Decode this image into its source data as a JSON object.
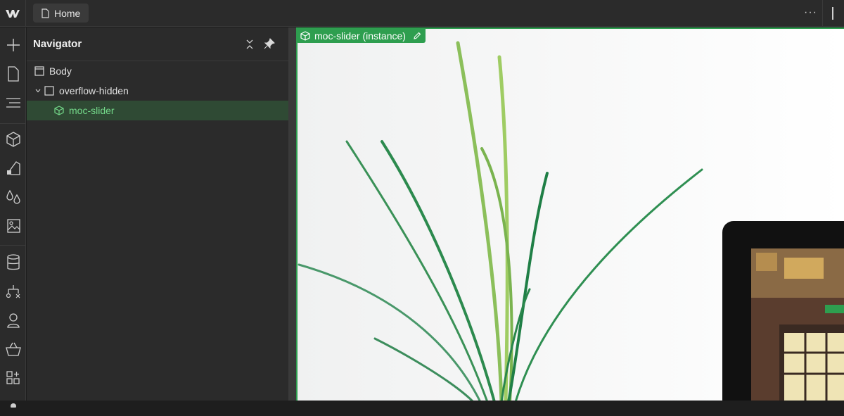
{
  "topbar": {
    "page_tab_label": "Home",
    "more_label": "···"
  },
  "left_rail": {
    "items": [
      {
        "name": "add-icon"
      },
      {
        "name": "pages-icon"
      },
      {
        "name": "navigator-icon"
      },
      {
        "name": "components-icon"
      },
      {
        "name": "style-selectors-icon"
      },
      {
        "name": "variables-icon"
      },
      {
        "name": "assets-icon"
      },
      {
        "name": "cms-icon"
      },
      {
        "name": "logic-icon"
      },
      {
        "name": "users-icon"
      },
      {
        "name": "ecommerce-icon"
      },
      {
        "name": "apps-icon"
      }
    ]
  },
  "navigator": {
    "title": "Navigator",
    "tree": [
      {
        "label": "Body",
        "icon": "body-icon",
        "depth": 0,
        "expanded": false,
        "selected": false
      },
      {
        "label": "overflow-hidden",
        "icon": "div-block-icon",
        "depth": 1,
        "expanded": true,
        "selected": false
      },
      {
        "label": "moc-slider",
        "icon": "component-instance-icon",
        "depth": 2,
        "expanded": false,
        "selected": true
      }
    ]
  },
  "canvas": {
    "selection_label": "moc-slider (instance)",
    "accent_color": "#2e9e4f",
    "selected_row_text_color": "#74d98a"
  }
}
